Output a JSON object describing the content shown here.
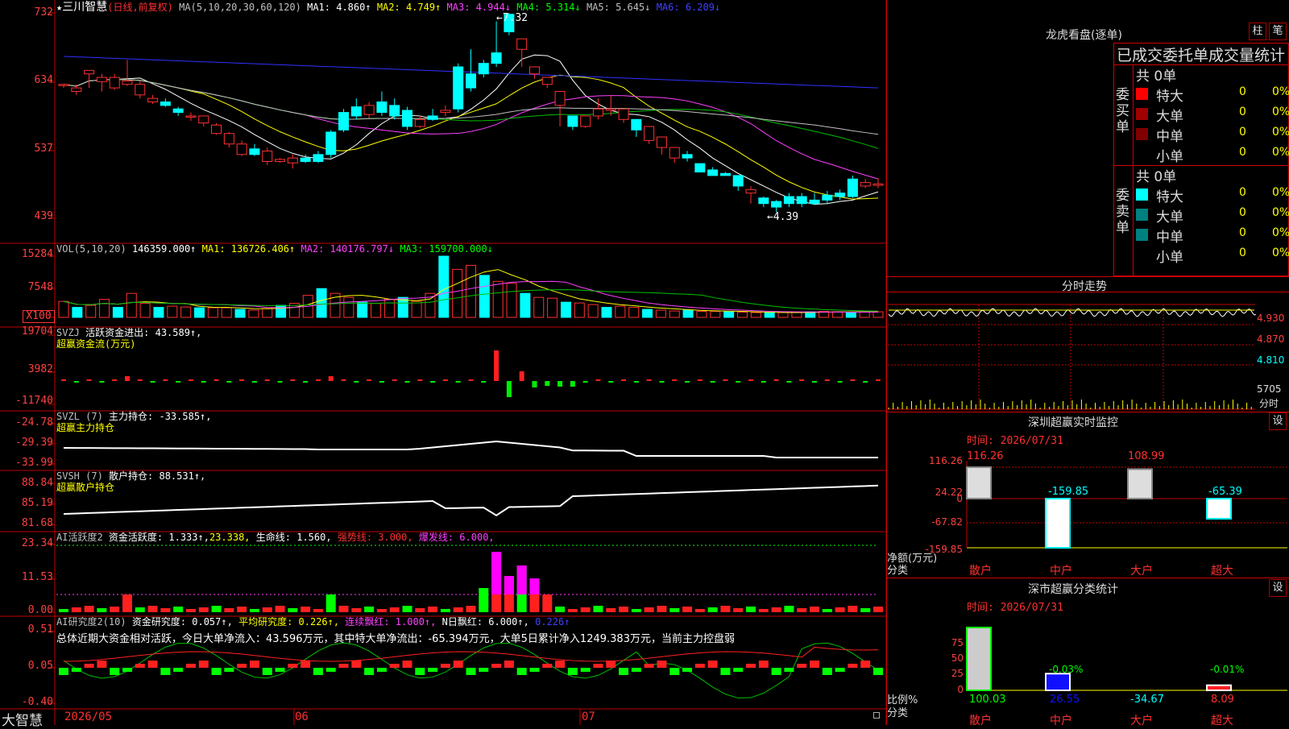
{
  "stock": {
    "star": "★",
    "name": "三川智慧",
    "period": "(日线,前复权)"
  },
  "main_header": {
    "ma_def": "MA(5,10,20,30,60,120)",
    "ma1": "MA1: 4.860↑",
    "ma2": "MA2: 4.749↑",
    "ma3": "MA3: 4.944↓",
    "ma4": "MA4: 5.314↓",
    "ma5": "MA5: 5.645↓",
    "ma6": "MA6: 6.209↓"
  },
  "main_ylabels": [
    "732",
    "634",
    "537",
    "439"
  ],
  "annotations": {
    "high": "7.32",
    "low": "4.39"
  },
  "vol_header": {
    "def": "VOL(5,10,20)",
    "val": "146359.000↑",
    "ma1": "MA1: 136726.406↑",
    "ma2": "MA2: 140176.797↓",
    "ma3": "MA3: 159700.000↓"
  },
  "vol_ylabels": [
    "15284",
    "7548",
    "X100"
  ],
  "svzj": {
    "def": "SVZJ",
    "label": "活跃资金进出: 43.589↑,",
    "sub": "超赢资金流(万元)",
    "ylabels": [
      "19704",
      "3982",
      "-11740"
    ]
  },
  "svzl": {
    "def": "SVZL (7)",
    "label": "主力持仓: -33.585↑,",
    "sub": "超赢主力持仓",
    "ylabels": [
      "-24.78",
      "-29.39",
      "-33.99"
    ]
  },
  "svsh": {
    "def": "SVSH (7)",
    "label": "散户持仓: 88.531↑,",
    "sub": "超赢散户持仓",
    "ylabels": [
      "88.84",
      "85.19",
      "81.68"
    ]
  },
  "ai1": {
    "def": "AI活跃度2",
    "l1": "资金活跃度: 1.333↑,",
    "l2": "23.338,",
    "l3": "生命线: 1.560,",
    "l4": "强势线: 3.000,",
    "l5": "爆发线: 6.000,",
    "ylabels": [
      "23.34",
      "11.53",
      "0.00"
    ]
  },
  "ai2": {
    "def": "AI研究度2(10)",
    "l1": "资金研究度: 0.057↑,",
    "l2": "平均研究度: 0.226↑,",
    "l3": "连续飘红: 1.000↑,",
    "l4": "N日飘红: 6.000↑,",
    "l5": "0.226↑",
    "summary": "总体近期大资金相对活跃，今日大单净流入：43.596万元，其中特大单净流出：-65.394万元，大单5日累计净入1249.383万元，当前主力控盘弱",
    "ylabels": [
      "0.51",
      "0.05",
      "-0.40"
    ]
  },
  "xaxis": {
    "brand": "大智慧",
    "dates": [
      "2026/05",
      "06",
      "07"
    ]
  },
  "lhb": {
    "title": "龙虎看盘(逐单)",
    "btn1": "柱",
    "btn2": "笔",
    "head": "已成交委托单成交量统计",
    "buy_label": "委买单",
    "sell_label": "委卖单",
    "buy_total": "共 0单",
    "sell_total": "共 0单",
    "buy_rows": [
      {
        "name": "特大",
        "v1": "0",
        "v2": "0%",
        "color": "#ff0000"
      },
      {
        "name": "大单",
        "v1": "0",
        "v2": "0%",
        "color": "#a00000"
      },
      {
        "name": "中单",
        "v1": "0",
        "v2": "0%",
        "color": "#800000"
      },
      {
        "name": "小单",
        "v1": "0",
        "v2": "0%",
        "color": ""
      }
    ],
    "sell_rows": [
      {
        "name": "特大",
        "v1": "0",
        "v2": "0%",
        "color": "#00ffff"
      },
      {
        "name": "大单",
        "v1": "0",
        "v2": "0%",
        "color": "#008080"
      },
      {
        "name": "中单",
        "v1": "0",
        "v2": "0%",
        "color": "#008080"
      },
      {
        "name": "小单",
        "v1": "0",
        "v2": "0%",
        "color": ""
      }
    ]
  },
  "fenshi": {
    "title": "分时走势",
    "ylabels": [
      "4.930",
      "4.870",
      "4.810",
      "5705"
    ],
    "tag": "分时"
  },
  "szmon": {
    "title": "深圳超赢实时监控",
    "btn": "设",
    "time": "时间: 2026/07/31",
    "ylabels": [
      "116.26",
      "24.22",
      "0",
      "-67.82",
      "-159.85"
    ],
    "ylabel_title": "净额(万元)",
    "xtitle": "分类",
    "cats": [
      "散户",
      "中户",
      "大户",
      "超大"
    ],
    "vals": [
      "116.26",
      "-159.85",
      "108.99",
      "-65.39"
    ]
  },
  "szstat": {
    "title": "深市超赢分类统计",
    "btn": "设",
    "time": "时间: 2026/07/31",
    "ylabels": [
      "75",
      "50",
      "25",
      "0"
    ],
    "ylabel_title": "比例%",
    "xtitle": "分类",
    "cats": [
      "散户",
      "中户",
      "大户",
      "超大"
    ],
    "top": [
      "",
      "-0.03%",
      "",
      "-0.01%"
    ],
    "vals": [
      "100.03",
      "26.55",
      "-34.67",
      "8.09"
    ]
  },
  "chart_data": [
    {
      "type": "candlestick",
      "title": "三川智慧 (日线,前复权)",
      "ylim": [
        4.39,
        7.32
      ],
      "annotations": {
        "high": 7.32,
        "low": 4.39
      },
      "ma": {
        "MA1": 4.86,
        "MA2": 4.749,
        "MA3": 4.944,
        "MA4": 5.314,
        "MA5": 5.645,
        "MA6": 6.209
      },
      "ohlc": [
        [
          6.29,
          6.3,
          6.27,
          6.25
        ],
        [
          6.2,
          6.25,
          6.3,
          6.15
        ],
        [
          6.45,
          6.5,
          6.35,
          6.25
        ],
        [
          6.34,
          6.4,
          6.45,
          6.2
        ],
        [
          6.25,
          6.4,
          6.45,
          6.22
        ],
        [
          6.3,
          6.35,
          6.65,
          6.28
        ],
        [
          6.15,
          6.3,
          6.35,
          6.1
        ],
        [
          6.05,
          6.1,
          6.15,
          6.02
        ],
        [
          6.05,
          6.0,
          6.1,
          5.98
        ],
        [
          5.95,
          5.9,
          5.98,
          5.85
        ],
        [
          5.84,
          5.85,
          5.9,
          5.78
        ],
        [
          5.75,
          5.85,
          5.8,
          5.7
        ],
        [
          5.6,
          5.72,
          5.75,
          5.58
        ],
        [
          5.45,
          5.6,
          5.62,
          5.4
        ],
        [
          5.3,
          5.45,
          5.5,
          5.28
        ],
        [
          5.38,
          5.3,
          5.45,
          5.28
        ],
        [
          5.2,
          5.35,
          5.4,
          5.15
        ],
        [
          5.2,
          5.23,
          5.25,
          5.18
        ],
        [
          5.18,
          5.25,
          5.3,
          5.1
        ],
        [
          5.25,
          5.2,
          5.3,
          5.18
        ],
        [
          5.3,
          5.2,
          5.35,
          5.18
        ],
        [
          5.62,
          5.3,
          5.65,
          5.25
        ],
        [
          5.9,
          5.65,
          5.95,
          5.62
        ],
        [
          5.98,
          5.85,
          6.1,
          5.8
        ],
        [
          5.87,
          6.0,
          6.05,
          5.82
        ],
        [
          6.05,
          5.9,
          6.2,
          5.85
        ],
        [
          6.0,
          5.85,
          6.1,
          5.8
        ],
        [
          5.93,
          5.7,
          5.98,
          5.65
        ],
        [
          5.7,
          5.8,
          5.85,
          5.68
        ],
        [
          5.85,
          5.8,
          5.95,
          5.78
        ],
        [
          5.9,
          5.93,
          6.0,
          5.85
        ],
        [
          6.55,
          5.95,
          6.6,
          5.9
        ],
        [
          6.45,
          6.25,
          6.8,
          6.2
        ],
        [
          6.6,
          6.45,
          6.65,
          6.4
        ],
        [
          6.75,
          6.6,
          7.2,
          6.55
        ],
        [
          7.3,
          7.05,
          7.32,
          7.0
        ],
        [
          6.8,
          6.95,
          6.85,
          6.55
        ],
        [
          6.45,
          6.55,
          6.5,
          6.38
        ],
        [
          6.3,
          6.4,
          6.35,
          6.25
        ],
        [
          6.0,
          6.2,
          6.05,
          5.7
        ],
        [
          5.85,
          5.7,
          5.75,
          5.65
        ],
        [
          5.7,
          5.85,
          5.85,
          5.68
        ],
        [
          5.85,
          5.95,
          6.1,
          5.8
        ],
        [
          5.93,
          5.95,
          6.15,
          5.85
        ],
        [
          5.8,
          5.95,
          5.9,
          5.75
        ],
        [
          5.8,
          5.65,
          5.6,
          5.55
        ],
        [
          5.5,
          5.7,
          5.6,
          5.45
        ],
        [
          5.4,
          5.55,
          5.45,
          5.3
        ],
        [
          5.25,
          5.4,
          5.3,
          5.18
        ],
        [
          5.3,
          5.25,
          5.35,
          5.2
        ],
        [
          5.17,
          5.05,
          5.12,
          5.1
        ],
        [
          5.08,
          5.0,
          5.12,
          5.0
        ],
        [
          5.03,
          5.0,
          5.05,
          5.0
        ],
        [
          5.0,
          4.85,
          4.95,
          4.78
        ],
        [
          4.75,
          4.8,
          4.85,
          4.6
        ],
        [
          4.68,
          4.6,
          4.7,
          4.55
        ],
        [
          4.63,
          4.55,
          4.65,
          4.48
        ],
        [
          4.7,
          4.6,
          4.75,
          4.55
        ],
        [
          4.7,
          4.6,
          4.75,
          4.55
        ],
        [
          4.65,
          4.6,
          4.75,
          4.58
        ],
        [
          4.72,
          4.65,
          4.78,
          4.6
        ],
        [
          4.75,
          4.7,
          4.8,
          4.65
        ],
        [
          4.95,
          4.7,
          5.0,
          4.68
        ],
        [
          4.85,
          4.9,
          4.95,
          4.82
        ],
        [
          4.86,
          4.88,
          4.96,
          4.82
        ]
      ]
    },
    {
      "type": "bar",
      "title": "VOL(5,10,20)",
      "values": [
        4.0,
        2.5,
        3.0,
        4.5,
        2.5,
        6.0,
        3.5,
        2.5,
        2.8,
        2.6,
        2.4,
        2.4,
        2.4,
        2.0,
        1.8,
        2.2,
        3.0,
        3.5,
        5.5,
        7.2,
        6.0,
        5.0,
        3.8,
        3.5,
        4.5,
        5.0,
        4.0,
        6.0,
        15.3,
        12.0,
        13.0,
        10.5,
        9.0,
        8.5,
        6.0,
        5.0,
        4.8,
        3.8,
        3.6,
        3.2,
        2.5,
        2.8,
        2.5,
        2.0,
        1.8,
        1.6,
        1.8,
        1.5,
        1.5,
        1.4,
        1.3,
        1.2,
        1.1,
        1.2,
        1.3,
        1.4,
        1.5,
        1.4,
        1.3,
        1.3,
        1.4
      ],
      "unit": "X100",
      "ylim": [
        0,
        15284
      ]
    }
  ]
}
